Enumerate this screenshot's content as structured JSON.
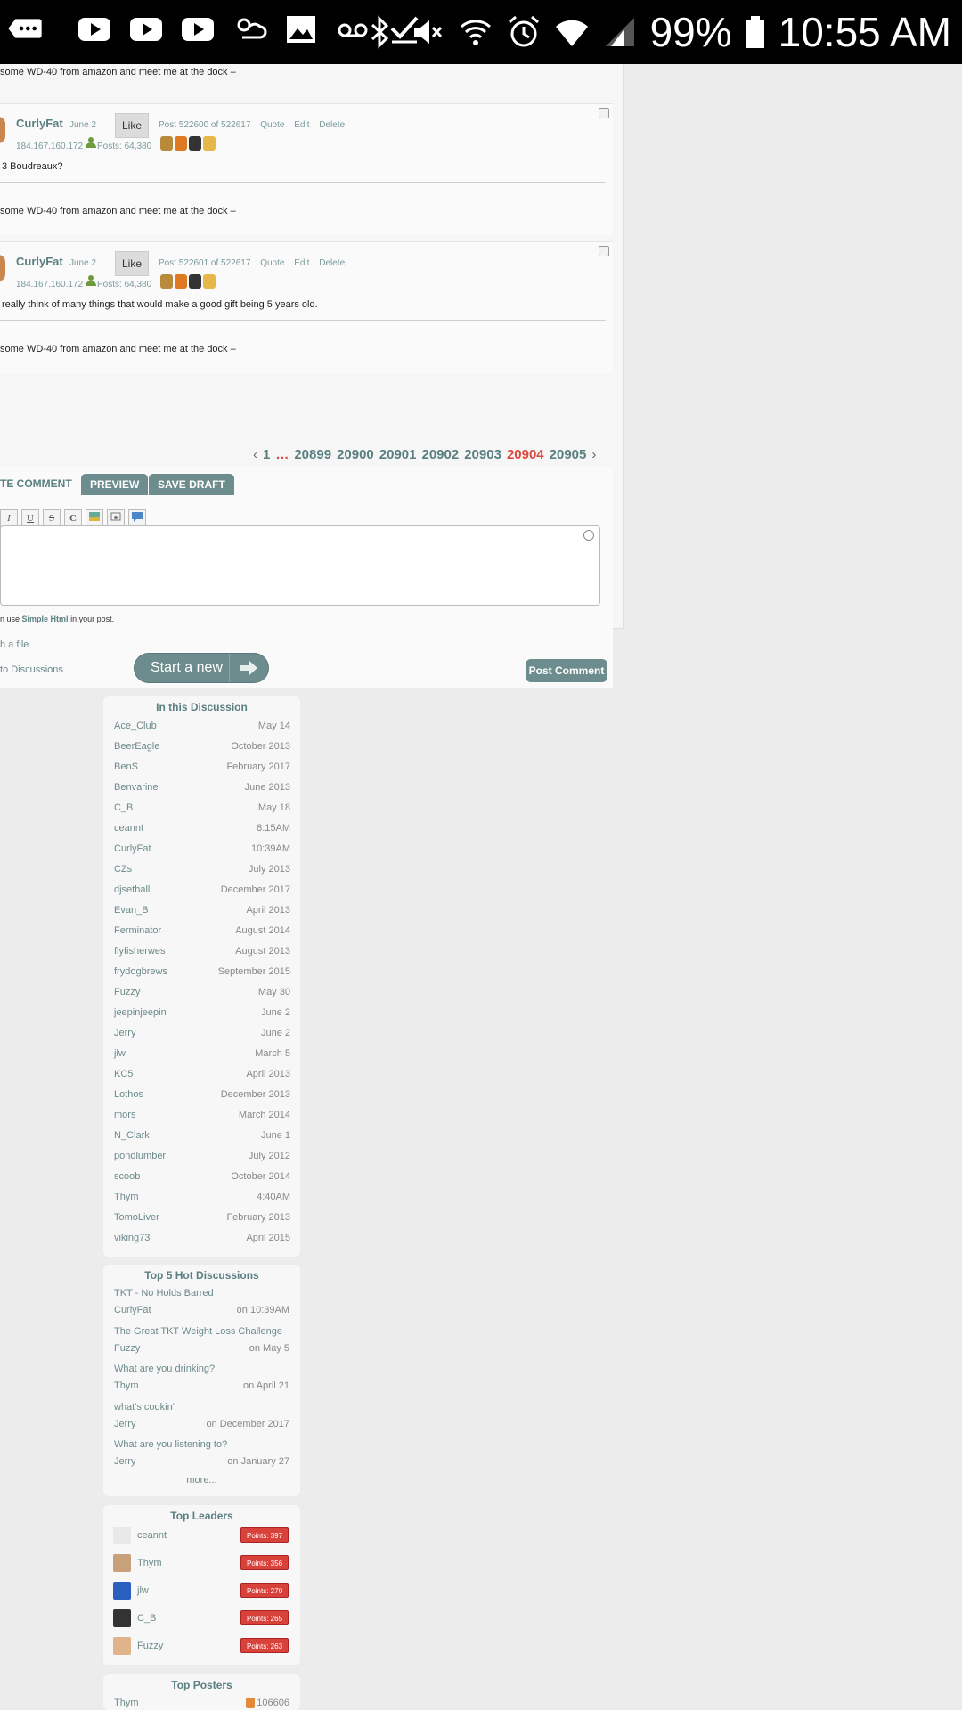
{
  "status_bar": {
    "battery": "99%",
    "time": "10:55 AM",
    "icons": [
      "more-icon",
      "youtube-icon",
      "youtube-icon",
      "youtube-icon",
      "weather-icon",
      "image-icon",
      "voicemail-icon",
      "check-icon",
      "bluetooth-icon",
      "mute-icon",
      "wifi-calling-icon",
      "alarm-icon",
      "wifi-icon",
      "signal-icon",
      "battery-icon"
    ]
  },
  "thread": {
    "top_signature": "some WD-40 from amazon and meet me at the dock –",
    "posts": [
      {
        "author": "CurlyFat",
        "date": "June 2",
        "like": "Like",
        "post_number": "Post 522600 of 522617",
        "actions": [
          "Quote",
          "Edit",
          "Delete"
        ],
        "ip": "184.167.160.172",
        "posts_count": "Posts: 64,380",
        "text": "3 Boudreaux?",
        "signature": "some WD-40 from amazon and meet me at the dock –"
      },
      {
        "author": "CurlyFat",
        "date": "June 2",
        "like": "Like",
        "post_number": "Post 522601 of 522617",
        "actions": [
          "Quote",
          "Edit",
          "Delete"
        ],
        "ip": "184.167.160.172",
        "posts_count": "Posts: 64,380",
        "text": "really think of many things that would make a good gift being 5 years old.",
        "signature": "some WD-40 from amazon and meet me at the dock –"
      }
    ],
    "pagination": {
      "prev": "‹",
      "first": "1",
      "ellipsis": "…",
      "pages": [
        "20899",
        "20900",
        "20901",
        "20902",
        "20903"
      ],
      "current": "20904",
      "last": "20905",
      "next": "›"
    }
  },
  "composer": {
    "tab_write": "TE COMMENT",
    "preview": "PREVIEW",
    "save_draft": "SAVE DRAFT",
    "tools": [
      "I",
      "U",
      "S",
      "C"
    ],
    "help_prefix": "n use",
    "help_link": "Simple Html",
    "help_suffix": "in your post.",
    "attach": "h a file",
    "back": "to Discussions",
    "post_button": "Post Comment"
  },
  "start_new": {
    "label": "Start a new"
  },
  "in_discussion": {
    "title": "In this Discussion",
    "rows": [
      {
        "name": "Ace_Club",
        "date": "May 14"
      },
      {
        "name": "BeerEagle",
        "date": "October 2013"
      },
      {
        "name": "BenS",
        "date": "February 2017"
      },
      {
        "name": "Benvarine",
        "date": "June 2013"
      },
      {
        "name": "C_B",
        "date": "May 18"
      },
      {
        "name": "ceannt",
        "date": "8:15AM"
      },
      {
        "name": "CurlyFat",
        "date": "10:39AM"
      },
      {
        "name": "CZs",
        "date": "July 2013"
      },
      {
        "name": "djsethall",
        "date": "December 2017"
      },
      {
        "name": "Evan_B",
        "date": "April 2013"
      },
      {
        "name": "Ferminator",
        "date": "August 2014"
      },
      {
        "name": "flyfisherwes",
        "date": "August 2013"
      },
      {
        "name": "frydogbrews",
        "date": "September 2015"
      },
      {
        "name": "Fuzzy",
        "date": "May 30"
      },
      {
        "name": "jeepinjeepin",
        "date": "June 2"
      },
      {
        "name": "Jerry",
        "date": "June 2"
      },
      {
        "name": "jlw",
        "date": "March 5"
      },
      {
        "name": "KC5",
        "date": "April 2013"
      },
      {
        "name": "Lothos",
        "date": "December 2013"
      },
      {
        "name": "mors",
        "date": "March 2014"
      },
      {
        "name": "N_Clark",
        "date": "June 1"
      },
      {
        "name": "pondlumber",
        "date": "July 2012"
      },
      {
        "name": "scoob",
        "date": "October 2014"
      },
      {
        "name": "Thym",
        "date": "4:40AM"
      },
      {
        "name": "TomoLiver",
        "date": "February 2013"
      },
      {
        "name": "viking73",
        "date": "April 2015"
      }
    ]
  },
  "hot_discussions": {
    "title": "Top 5 Hot Discussions",
    "items": [
      {
        "title": "TKT - No Holds Barred",
        "user": "CurlyFat",
        "date": "on 10:39AM"
      },
      {
        "title": "The Great TKT Weight Loss Challenge",
        "user": "Fuzzy",
        "date": "on May 5"
      },
      {
        "title": "What are you drinking?",
        "user": "Thym",
        "date": "on April 21"
      },
      {
        "title": "what's cookin'",
        "user": "Jerry",
        "date": "on December 2017"
      },
      {
        "title": "What are you listening to?",
        "user": "Jerry",
        "date": "on January 27"
      }
    ],
    "more": "more..."
  },
  "top_leaders": {
    "title": "Top Leaders",
    "items": [
      {
        "name": "ceannt",
        "points": "Points: 397",
        "avatar_color": "#e9e9e9"
      },
      {
        "name": "Thym",
        "points": "Points: 356",
        "avatar_color": "#c8a07a"
      },
      {
        "name": "jlw",
        "points": "Points: 270",
        "avatar_color": "#2a5fbf"
      },
      {
        "name": "C_B",
        "points": "Points: 265",
        "avatar_color": "#333333"
      },
      {
        "name": "Fuzzy",
        "points": "Points: 263",
        "avatar_color": "#e0b48a"
      }
    ]
  },
  "top_posters": {
    "title": "Top Posters",
    "first_name": "Thym",
    "first_count": "106606"
  }
}
